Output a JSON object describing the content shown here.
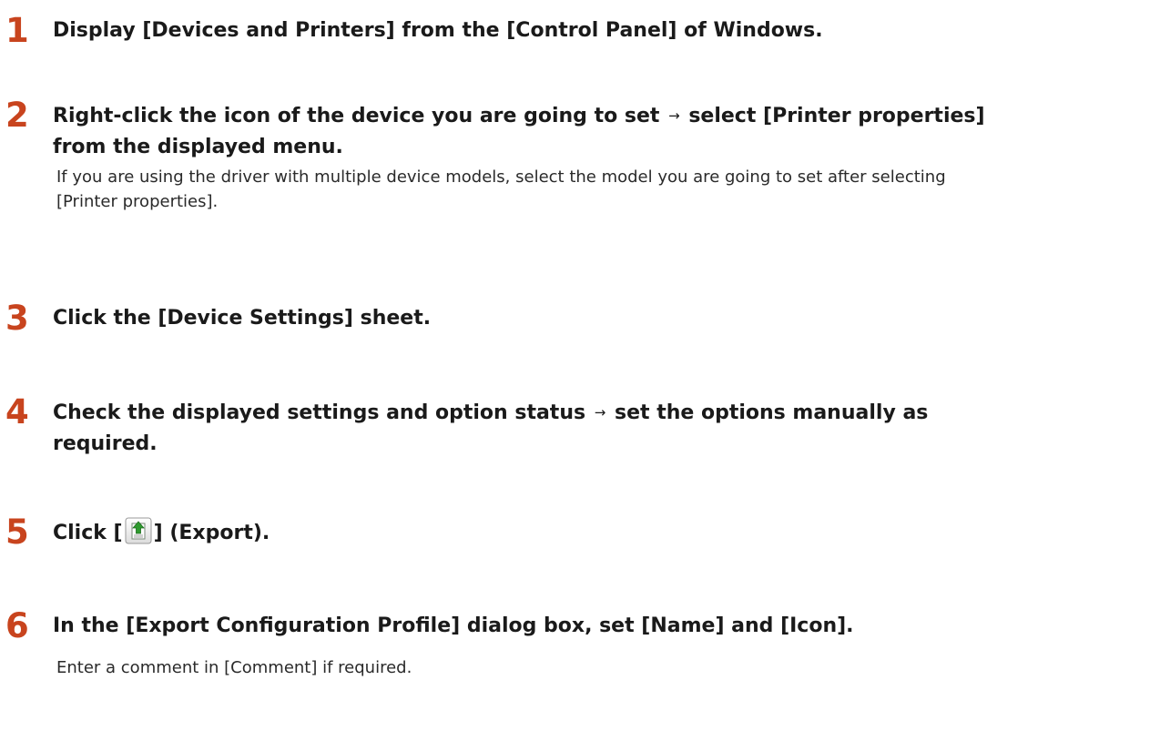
{
  "steps": [
    {
      "number": "1",
      "title": "Display [Devices and Printers] from the [Control Panel] of Windows."
    },
    {
      "number": "2",
      "title_a": "Right-click the icon of the device you are going to set",
      "arrow": "→",
      "title_b": "select [Printer properties]",
      "title_c": "from the displayed menu.",
      "desc_line1": "If you are using the driver with multiple device models, select the model you are going to set after selecting",
      "desc_line2": "[Printer properties]."
    },
    {
      "number": "3",
      "title": "Click the [Device Settings] sheet."
    },
    {
      "number": "4",
      "title_a": "Check the displayed settings and option status",
      "arrow": "→",
      "title_b": "set the options manually as",
      "title_c": "required."
    },
    {
      "number": "5",
      "title_prefix": "Click [",
      "icon": "export-icon",
      "title_suffix": "] (Export)."
    },
    {
      "number": "6",
      "title": "In the [Export Configuration Profile] dialog box, set [Name] and [Icon].",
      "desc": "Enter a comment in [Comment] if required."
    }
  ],
  "colors": {
    "step_number": "#c8441e",
    "text": "#1a1a1a"
  }
}
